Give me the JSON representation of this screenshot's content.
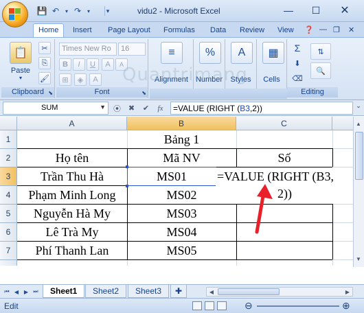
{
  "window": {
    "title": "vidu2 - Microsoft Excel",
    "minimize_icon": "minimize-icon",
    "maximize_icon": "maximize-icon",
    "close_icon": "close-icon"
  },
  "ribbon": {
    "tabs": [
      "Home",
      "Insert",
      "Page Layout",
      "Formulas",
      "Data",
      "Review",
      "View"
    ],
    "active_tab": "Home",
    "groups": {
      "clipboard": {
        "label": "Clipboard",
        "paste": "Paste"
      },
      "font": {
        "label": "Font",
        "font_name": "Times New Ro",
        "font_size": "16"
      },
      "alignment": {
        "label": "Alignment"
      },
      "number": {
        "label": "Number"
      },
      "styles": {
        "label": "Styles"
      },
      "cells": {
        "label": "Cells"
      },
      "editing": {
        "label": "Editing"
      }
    },
    "watermark": "Quantrimang"
  },
  "formula_bar": {
    "name_box": "SUM",
    "formula_prefix": "=VALUE (RIGHT (",
    "formula_ref": "B3",
    "formula_suffix": ",2))"
  },
  "sheet": {
    "columns": [
      "A",
      "B",
      "C"
    ],
    "rows": [
      "1",
      "2",
      "3",
      "4",
      "5",
      "6",
      "7"
    ],
    "title": "Bảng 1",
    "headers": {
      "a": "Họ tên",
      "b": "Mã NV",
      "c": "Số"
    },
    "data": [
      {
        "name": "Trần Thu Hà",
        "code": "MS01"
      },
      {
        "name": "Phạm Minh Long",
        "code": "MS02"
      },
      {
        "name": "Nguyễn Hà My",
        "code": "MS03"
      },
      {
        "name": "Lê Trà My",
        "code": "MS04"
      },
      {
        "name": "Phí Thanh Lan",
        "code": "MS05"
      }
    ],
    "editing_text_line1": "=VALUE (RIGHT (B3,",
    "editing_text_line2": "2))"
  },
  "sheet_tabs": [
    "Sheet1",
    "Sheet2",
    "Sheet3"
  ],
  "active_sheet": "Sheet1",
  "status": {
    "mode": "Edit"
  },
  "colors": {
    "accent": "#15428b",
    "selection": "#f1c15f",
    "arrow": "#e8202a"
  }
}
